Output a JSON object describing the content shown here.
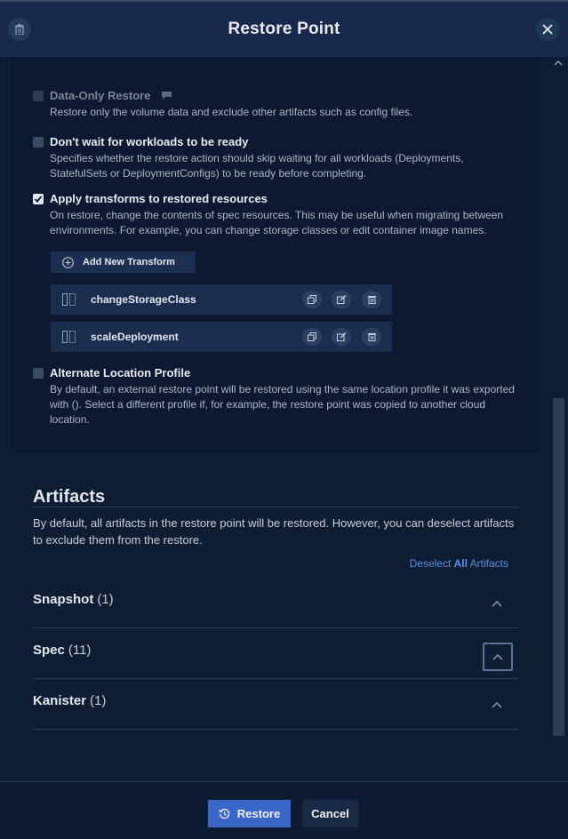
{
  "dialog": {
    "title": "Restore Point"
  },
  "options": {
    "data_only": {
      "label": "Data-Only Restore",
      "description": "Restore only the volume data and exclude other artifacts such as config files.",
      "checked": false,
      "disabled": true
    },
    "dont_wait": {
      "label": "Don't wait for workloads to be ready",
      "description": "Specifies whether the restore action should skip waiting for all workloads (Deployments, StatefulSets or DeploymentConfigs) to be ready before completing.",
      "checked": false
    },
    "apply_transforms": {
      "label": "Apply transforms to restored resources",
      "description": "On restore, change the contents of spec resources. This may be useful when migrating between environments. For example, you can change storage classes or edit container image names.",
      "checked": true
    },
    "alternate_location": {
      "label": "Alternate Location Profile",
      "description": "By default, an external restore point will be restored using the same location profile it was exported with (). Select a different profile if, for example, the restore point was copied to another cloud location.",
      "checked": false
    }
  },
  "transforms": {
    "add_label": "Add New Transform",
    "items": [
      {
        "name": "changeStorageClass"
      },
      {
        "name": "scaleDeployment"
      }
    ]
  },
  "artifacts": {
    "title": "Artifacts",
    "description": "By default, all artifacts in the restore point will be restored. However, you can deselect artifacts to exclude them from the restore.",
    "deselect_prefix": "Deselect ",
    "deselect_bold": "All",
    "deselect_suffix": " Artifacts",
    "sections": [
      {
        "name": "Snapshot",
        "count": "(1)"
      },
      {
        "name": "Spec",
        "count": "(11)"
      },
      {
        "name": "Kanister",
        "count": "(1)"
      }
    ]
  },
  "footer": {
    "restore_label": "Restore",
    "cancel_label": "Cancel"
  },
  "colors": {
    "primary": "#3a67c7",
    "link": "#5b8fe6",
    "header": "#17284a"
  }
}
